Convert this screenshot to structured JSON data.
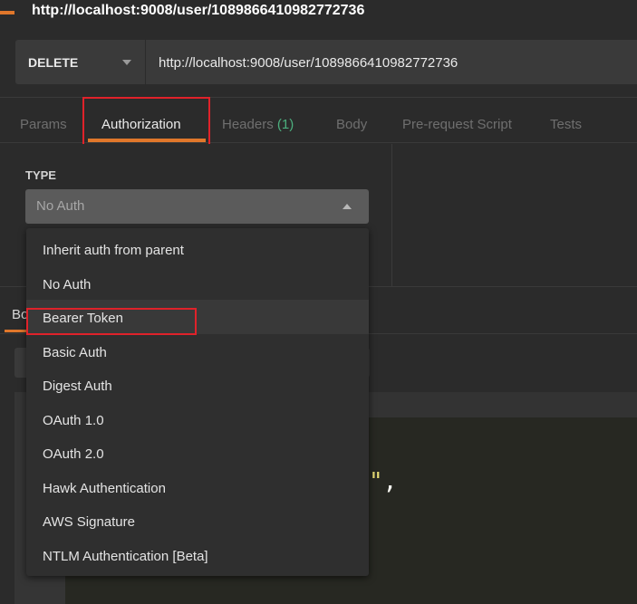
{
  "window": {
    "title": "http://localhost:9008/user/1089866410982772736"
  },
  "request": {
    "method": "DELETE",
    "url": "http://localhost:9008/user/1089866410982772736"
  },
  "tabs": [
    {
      "label": "Params"
    },
    {
      "label": "Authorization"
    },
    {
      "label": "Headers",
      "count": "(1)"
    },
    {
      "label": "Body"
    },
    {
      "label": "Pre-request Script"
    },
    {
      "label": "Tests"
    }
  ],
  "auth": {
    "type_label": "TYPE",
    "selected": "No Auth",
    "options": [
      "Inherit auth from parent",
      "No Auth",
      "Bearer Token",
      "Basic Auth",
      "Digest Auth",
      "OAuth 1.0",
      "OAuth 2.0",
      "Hawk Authentication",
      "AWS Signature",
      "NTLM Authentication [Beta]"
    ]
  },
  "response": {
    "tab_partial": "Bo",
    "code_quote": "\"",
    "code_comma": ","
  },
  "colors": {
    "accent": "#e0772b",
    "highlight_box": "#e0222a",
    "count_green": "#4caf7e"
  },
  "icons": {
    "method_caret": "chevron-down-icon",
    "type_caret": "chevron-up-icon"
  }
}
